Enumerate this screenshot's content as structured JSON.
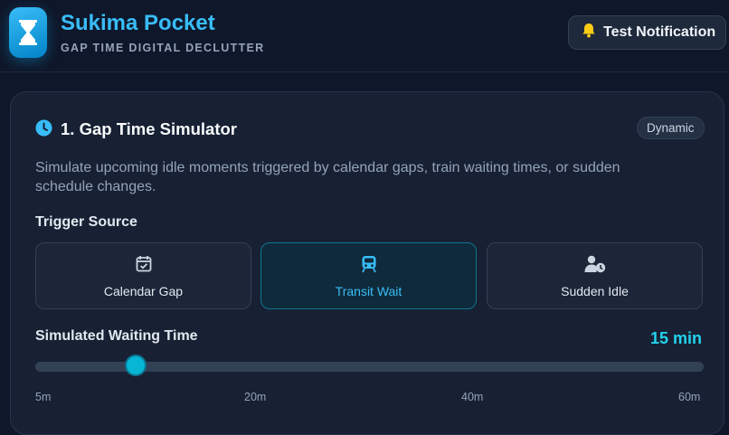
{
  "app": {
    "title": "Sukima Pocket",
    "subtitle": "GAP TIME DIGITAL DECLUTTER",
    "notification_button": "Test Notification"
  },
  "simulator": {
    "title": "1. Gap Time Simulator",
    "badge": "Dynamic",
    "description": "Simulate upcoming idle moments triggered by calendar gaps, train waiting times, or sudden schedule changes.",
    "trigger_title": "Trigger Source",
    "triggers": [
      {
        "label": "Calendar Gap",
        "icon": "calendar-check-icon",
        "active": false
      },
      {
        "label": "Transit Wait",
        "icon": "train-icon",
        "active": true
      },
      {
        "label": "Sudden Idle",
        "icon": "user-clock-icon",
        "active": false
      }
    ],
    "waiting_title": "Simulated Waiting Time",
    "waiting_value": "15 min",
    "slider": {
      "min": 5,
      "max": 60,
      "value": 15
    },
    "ticks": [
      "5m",
      "20m",
      "40m",
      "60m"
    ]
  },
  "colors": {
    "accent": "#38bdf8",
    "value": "#22d3ee",
    "background": "#0f172a",
    "card": "#172133"
  }
}
